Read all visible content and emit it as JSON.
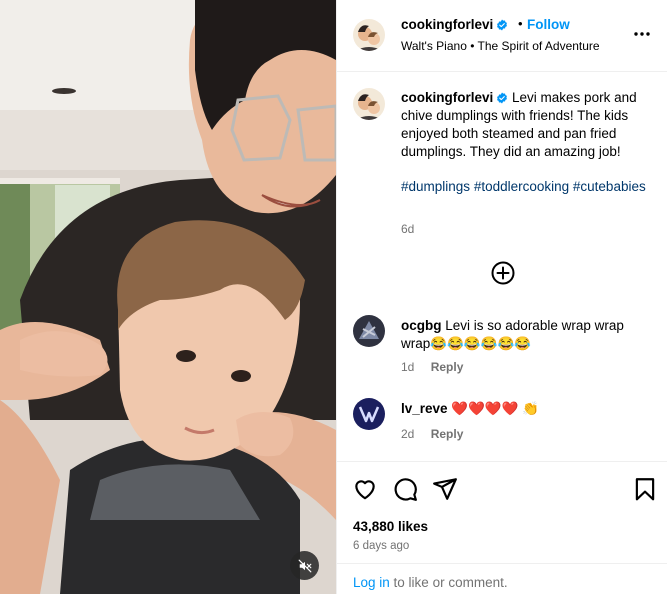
{
  "post": {
    "username": "cookingforlevi",
    "follow_label": "Follow",
    "separator": "•",
    "audio": "Walt's Piano • The Spirit of Adventure",
    "caption": "Levi makes pork and chive dumplings with friends! The kids enjoyed both steamed and pan fried dumplings. They did an amazing job!",
    "hashtags": [
      "#dumplings",
      "#toddlercooking",
      "#cutebabies"
    ],
    "caption_age": "6d",
    "likes": "43,880 likes",
    "posted_ago": "6 days ago"
  },
  "comments": [
    {
      "username": "ocgbg",
      "text": "Levi is so adorable wrap wrap wrap😂😂😂😂😂😂",
      "age": "1d",
      "reply_label": "Reply"
    },
    {
      "username": "lv_reve",
      "text": "❤️❤️❤️❤️ 👏",
      "age": "2d",
      "reply_label": "Reply"
    }
  ],
  "login": {
    "link_text": "Log in",
    "rest_text": " to like or comment."
  },
  "icons": {
    "verified": "verified-badge-icon",
    "more": "more-options-icon",
    "load_more": "add-circle-icon",
    "like": "heart-icon",
    "comment": "comment-bubble-icon",
    "share": "paper-plane-icon",
    "save": "bookmark-icon",
    "mute": "speaker-muted-icon"
  },
  "colors": {
    "accent": "#0095f6",
    "hashtag": "#00376b",
    "muted": "#737373"
  }
}
